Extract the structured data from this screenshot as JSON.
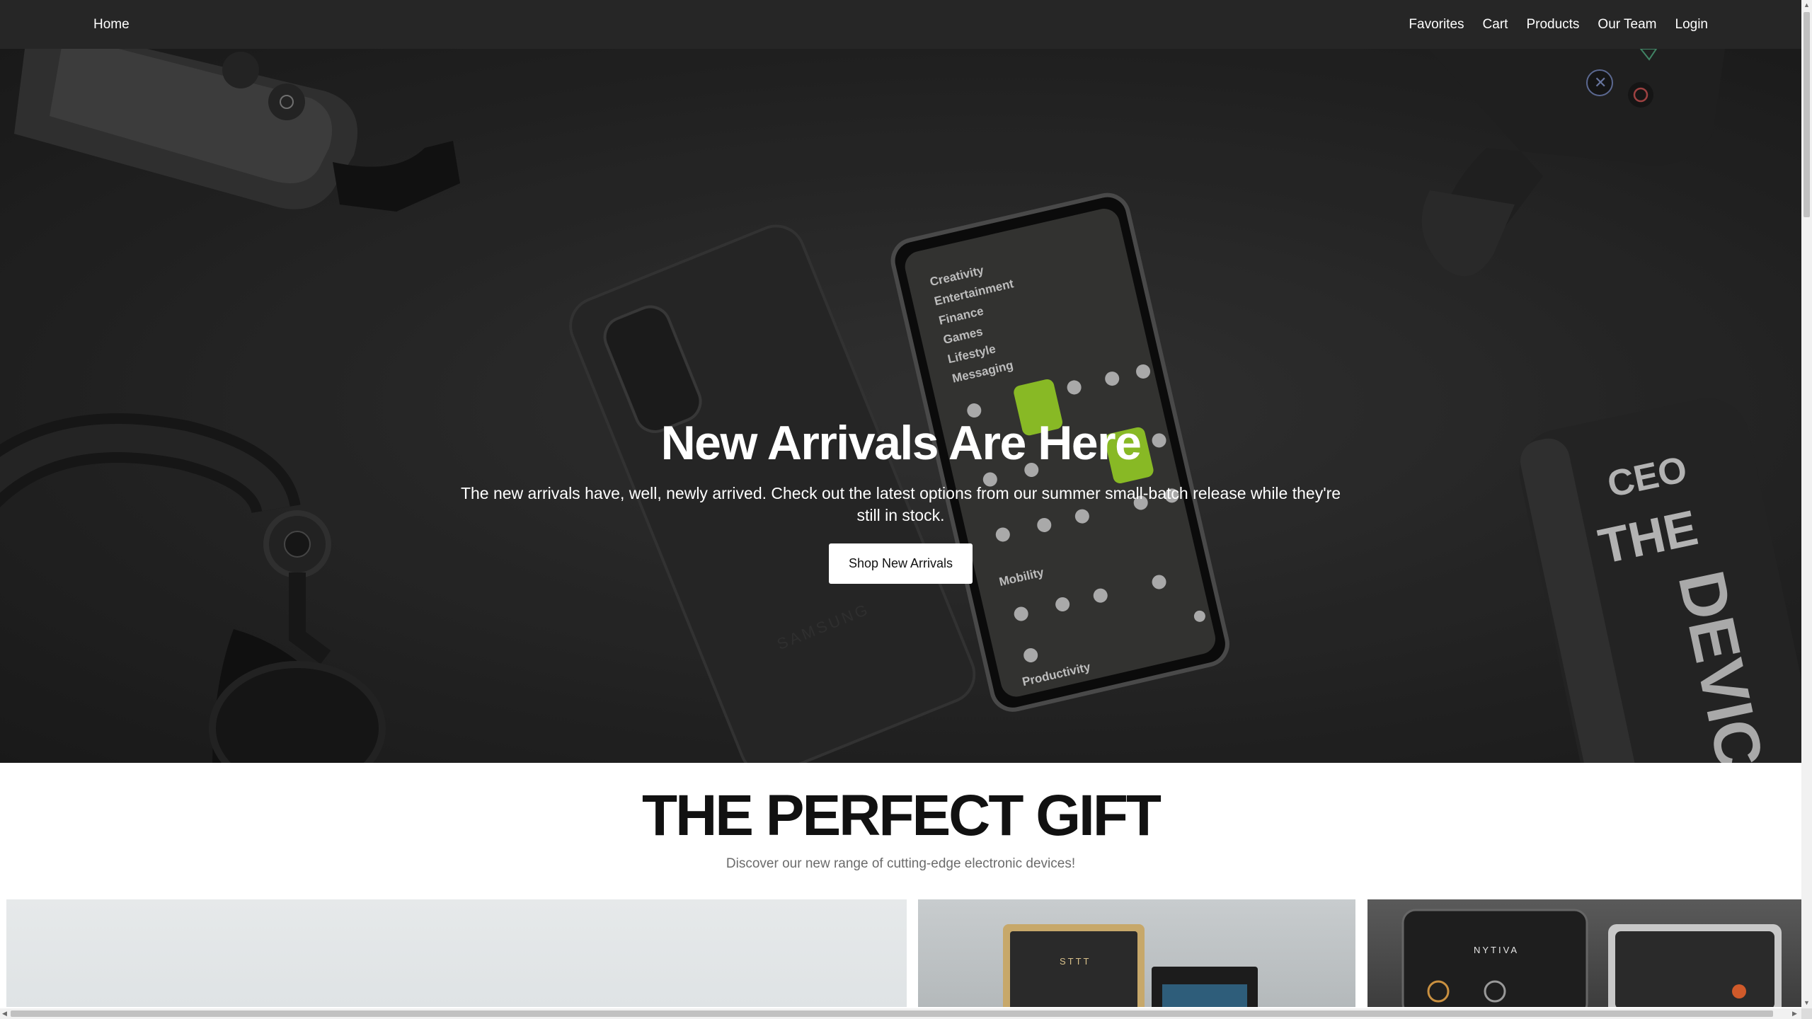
{
  "nav": {
    "home": "Home",
    "links": [
      "Favorites",
      "Cart",
      "Products",
      "Our Team",
      "Login"
    ]
  },
  "hero": {
    "title": "New Arrivals Are Here",
    "description": "The new arrivals have, well, newly arrived. Check out the latest options from our summer small-batch release while they're still in stock.",
    "button": "Shop New Arrivals",
    "phone_categories": [
      "Creativity",
      "Entertainment",
      "Finance",
      "Games",
      "Lifestyle",
      "Messaging",
      "Mobility",
      "Productivity"
    ],
    "bottle_text": [
      "CEO",
      "THE",
      "DEVICE"
    ],
    "accent": "#a6e22e"
  },
  "gift": {
    "title": "THE PERFECT GIFT",
    "subtitle": "Discover our new range of cutting-edge electronic devices!"
  },
  "cards": [
    {
      "name": "product-card-1"
    },
    {
      "name": "product-card-2",
      "caption": "STTT"
    },
    {
      "name": "product-card-3",
      "caption": "NYTIVA"
    }
  ],
  "icons": {
    "scroll_up": "scroll-up-arrow-icon",
    "scroll_down": "scroll-down-arrow-icon",
    "scroll_left": "scroll-left-arrow-icon",
    "scroll_right": "scroll-right-arrow-icon"
  }
}
